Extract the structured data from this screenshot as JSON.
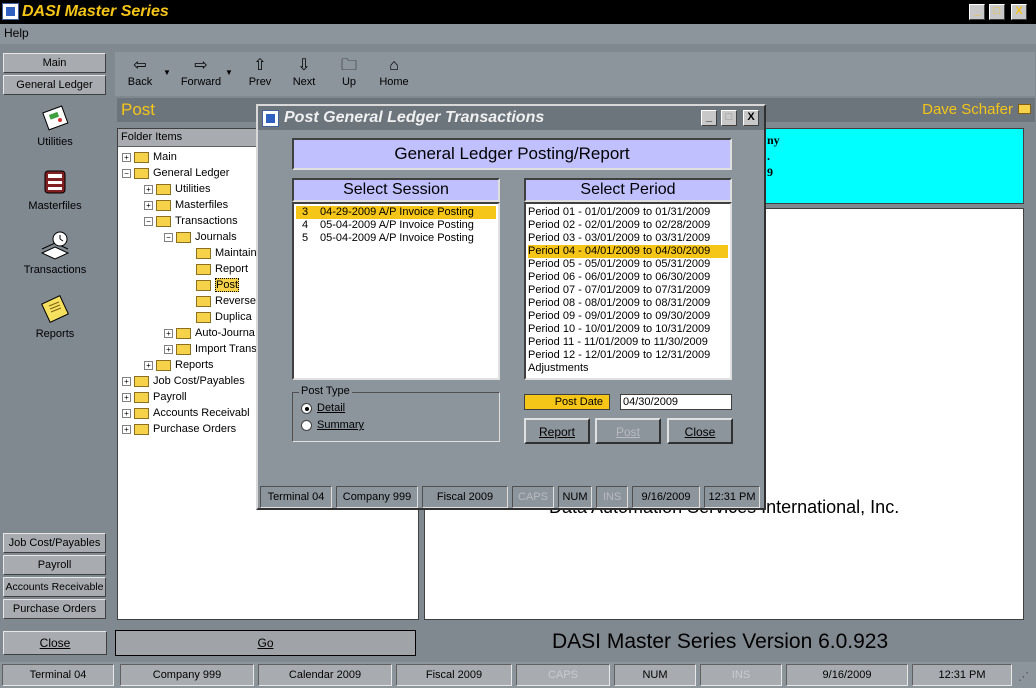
{
  "window": {
    "title": "DASI Master Series",
    "minimize": "_",
    "maximize": "□",
    "close": "X"
  },
  "menu": {
    "help": "Help"
  },
  "leftnav": {
    "top_buttons": [
      "Main",
      "General Ledger"
    ],
    "icons": [
      {
        "label": "Utilities",
        "icon": "utilities-icon"
      },
      {
        "label": "Masterfiles",
        "icon": "masterfiles-icon"
      },
      {
        "label": "Transactions",
        "icon": "transactions-icon"
      },
      {
        "label": "Reports",
        "icon": "reports-icon"
      }
    ],
    "bottom_buttons": [
      "Job Cost/Payables",
      "Payroll",
      "Accounts Receivable",
      "Purchase Orders"
    ]
  },
  "toolbar": {
    "back": "Back",
    "forward": "Forward",
    "prev": "Prev",
    "next": "Next",
    "up": "Up",
    "home": "Home"
  },
  "header": {
    "title": "Post",
    "user": "Dave Schafer"
  },
  "tree": {
    "header": "Folder Items",
    "nodes": [
      {
        "label": "Main",
        "exp": "+"
      },
      {
        "label": "General Ledger",
        "exp": "−"
      },
      {
        "label": "Utilities",
        "exp": "+"
      },
      {
        "label": "Masterfiles",
        "exp": "+"
      },
      {
        "label": "Transactions",
        "exp": "−"
      },
      {
        "label": "Journals",
        "exp": "−"
      },
      {
        "label": "Maintain",
        "exp": ""
      },
      {
        "label": "Report",
        "exp": ""
      },
      {
        "label": "Post",
        "exp": ""
      },
      {
        "label": "Reverse",
        "exp": ""
      },
      {
        "label": "Duplica",
        "exp": ""
      },
      {
        "label": "Auto-Journa",
        "exp": "+"
      },
      {
        "label": "Import Trans",
        "exp": "+"
      },
      {
        "label": "Reports",
        "exp": "+"
      },
      {
        "label": "Job Cost/Payables",
        "exp": "+"
      },
      {
        "label": "Payroll",
        "exp": "+"
      },
      {
        "label": "Accounts Receivabl",
        "exp": "+"
      },
      {
        "label": "Purchase Orders",
        "exp": "+"
      }
    ]
  },
  "right": {
    "cyan_fragments": [
      "ny",
      ".",
      "9"
    ],
    "company_name": "Data Automation Services International, Inc."
  },
  "dialog": {
    "title": "Post General Ledger Transactions",
    "heading": "General Ledger Posting/Report",
    "session_header": "Select Session",
    "sessions": [
      {
        "num": "3",
        "text": "04-29-2009 A/P Invoice Posting"
      },
      {
        "num": "4",
        "text": "05-04-2009 A/P Invoice Posting"
      },
      {
        "num": "5",
        "text": "05-04-2009 A/P Invoice Posting"
      }
    ],
    "period_header": "Select Period",
    "periods": [
      "Period 01 - 01/01/2009 to 01/31/2009",
      "Period 02 - 02/01/2009 to 02/28/2009",
      "Period 03 - 03/01/2009 to 03/31/2009",
      "Period 04 - 04/01/2009 to 04/30/2009",
      "Period 05 - 05/01/2009 to 05/31/2009",
      "Period 06 - 06/01/2009 to 06/30/2009",
      "Period 07 - 07/01/2009 to 07/31/2009",
      "Period 08 - 08/01/2009 to 08/31/2009",
      "Period 09 - 09/01/2009 to 09/30/2009",
      "Period 10 - 10/01/2009 to 10/31/2009",
      "Period 11 - 11/01/2009 to 11/30/2009",
      "Period 12 - 12/01/2009 to 12/31/2009",
      "Adjustments"
    ],
    "post_type_label": "Post Type",
    "post_type_detail": "Detail",
    "post_type_summary": "Summary",
    "post_date_label": "Post Date",
    "post_date_value": "04/30/2009",
    "report_btn": "Report",
    "post_btn": "Post",
    "close_btn": "Close",
    "status": [
      "Terminal 04",
      "Company 999",
      "Fiscal 2009",
      "CAPS",
      "NUM",
      "INS",
      "9/16/2009",
      "12:31 PM"
    ]
  },
  "bottom": {
    "close": "Close",
    "go": "Go",
    "version": "DASI Master Series Version 6.0.923"
  },
  "statusbar": [
    "Terminal 04",
    "Company 999",
    "Calendar 2009",
    "Fiscal 2009",
    "CAPS",
    "NUM",
    "INS",
    "9/16/2009",
    "12:31 PM"
  ]
}
